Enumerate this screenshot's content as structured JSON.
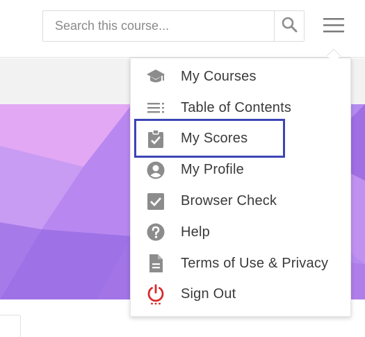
{
  "search": {
    "placeholder": "Search this course..."
  },
  "header": {
    "search_icon": "magnifier-icon",
    "menu_icon": "hamburger-icon"
  },
  "menu": {
    "items": [
      {
        "label": "My Courses",
        "icon": "graduation-cap-icon"
      },
      {
        "label": "Table of Contents",
        "icon": "list-icon"
      },
      {
        "label": "My Scores",
        "icon": "clipboard-check-icon"
      },
      {
        "label": "My Profile",
        "icon": "account-circle-icon"
      },
      {
        "label": "Browser Check",
        "icon": "checkbox-icon"
      },
      {
        "label": "Help",
        "icon": "help-circle-icon"
      },
      {
        "label": "Terms of Use & Privacy",
        "icon": "document-icon"
      },
      {
        "label": "Sign Out",
        "icon": "power-icon"
      }
    ]
  },
  "colors": {
    "icon_gray": "#8c8c8c",
    "sign_out_red": "#d62b2b",
    "highlight_border": "#3c45b5",
    "banner_violet": "#b58bf0"
  }
}
